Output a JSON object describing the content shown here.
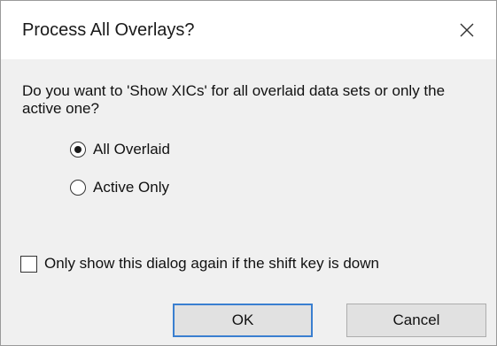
{
  "dialog": {
    "title": "Process All Overlays?",
    "close_icon": "close-icon",
    "message": "Do you want to 'Show XICs' for all overlaid data sets or only the active one?",
    "options": [
      {
        "label": "All Overlaid",
        "checked": true
      },
      {
        "label": "Active Only",
        "checked": false
      }
    ],
    "checkbox": {
      "label": "Only show this dialog again if the shift key is down",
      "checked": false
    },
    "buttons": {
      "ok": "OK",
      "cancel": "Cancel"
    },
    "colors": {
      "body": "#f0f0f0",
      "titlebar": "#ffffff",
      "button": "#e1e1e1",
      "focus_border": "#3a7fd0"
    }
  }
}
